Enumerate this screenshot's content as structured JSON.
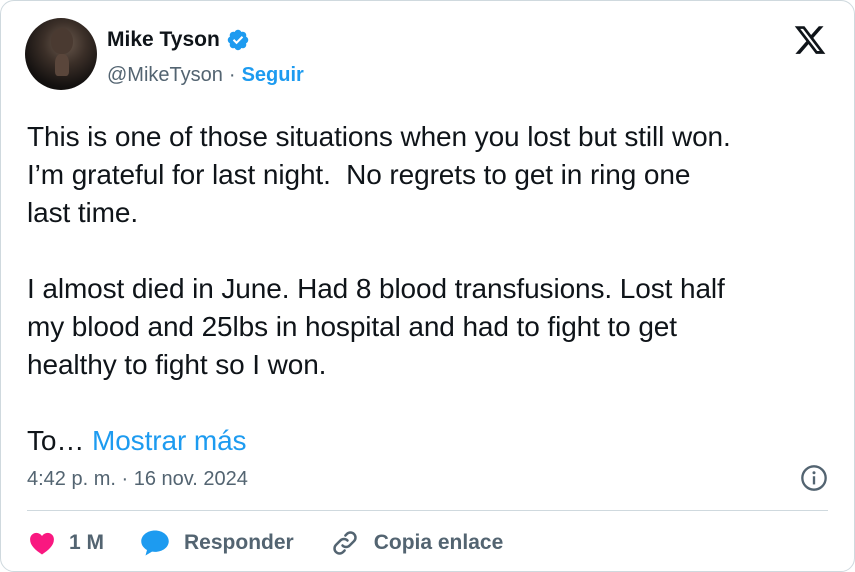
{
  "author": {
    "name": "Mike Tyson",
    "handle": "@MikeTyson",
    "separator": "·",
    "follow_label": "Seguir"
  },
  "tweet": {
    "paragraphs": [
      "This is one of those situations when you lost but still won.\nI’m grateful for last night.  No regrets to get in ring one\nlast time.",
      "I almost died in June. Had 8 blood transfusions. Lost half\nmy blood and 25lbs in hospital and had to fight to get\nhealthy to fight so I won."
    ],
    "truncated_text": "To…",
    "show_more_label": "Mostrar más"
  },
  "meta": {
    "timestamp": "4:42 p. m. · 16 nov. 2024"
  },
  "actions": {
    "likes": "1 M",
    "reply_label": "Responder",
    "copy_link_label": "Copia enlace"
  },
  "colors": {
    "accent": "#1d9bf0",
    "like": "#f91880",
    "muted": "#536471"
  },
  "icons": [
    "verified-badge-icon",
    "x-logo-icon",
    "info-icon",
    "heart-icon",
    "reply-bubble-icon",
    "link-icon"
  ]
}
